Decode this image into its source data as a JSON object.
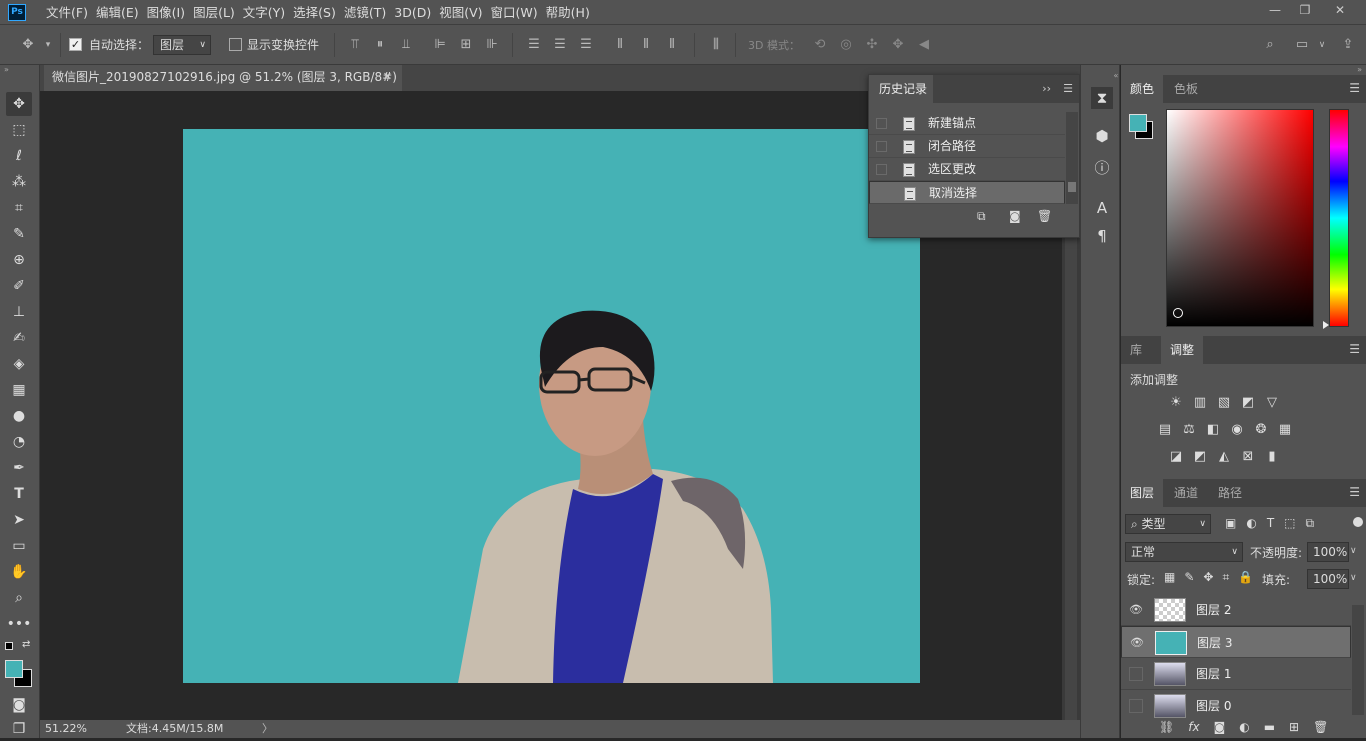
{
  "app": {
    "logo": "Ps",
    "menus": [
      "文件(F)",
      "编辑(E)",
      "图像(I)",
      "图层(L)",
      "文字(Y)",
      "选择(S)",
      "滤镜(T)",
      "3D(D)",
      "视图(V)",
      "窗口(W)",
      "帮助(H)"
    ]
  },
  "options": {
    "auto_select_label": "自动选择：",
    "auto_select_target": "图层",
    "show_transform_label": "显示变换控件",
    "mode_3d_label": "3D 模式："
  },
  "document": {
    "tab_title": "微信图片_20190827102916.jpg @ 51.2% (图层 3, RGB/8#) *",
    "canvas_color": "#45b2b5"
  },
  "status": {
    "zoom": "51.22%",
    "doc_info": "文档:4.45M/15.8M"
  },
  "history": {
    "title": "历史记录",
    "items": [
      {
        "label": "新建锚点"
      },
      {
        "label": "闭合路径"
      },
      {
        "label": "选区更改"
      },
      {
        "label": "取消选择"
      }
    ]
  },
  "color_panel": {
    "tabs": [
      "颜色",
      "色板"
    ],
    "foreground": "#45b2b5",
    "background": "#000000"
  },
  "adjust_panel": {
    "tabs": [
      "库",
      "调整"
    ],
    "add_label": "添加调整"
  },
  "layers_panel": {
    "tabs": [
      "图层",
      "通道",
      "路径"
    ],
    "filter_label": "类型",
    "blend_mode": "正常",
    "opacity_label": "不透明度:",
    "opacity_value": "100%",
    "lock_label": "锁定:",
    "fill_label": "填充:",
    "fill_value": "100%",
    "layers": [
      {
        "name": "图层 2",
        "visible": true
      },
      {
        "name": "图层 3",
        "visible": true,
        "selected": true
      },
      {
        "name": "图层 1",
        "visible": false
      },
      {
        "name": "图层 0",
        "visible": false
      }
    ]
  }
}
